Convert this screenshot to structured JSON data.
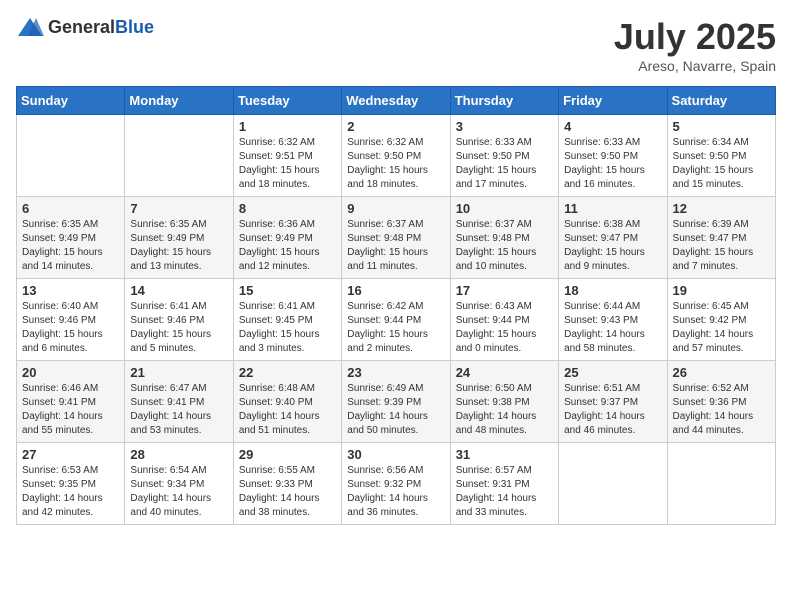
{
  "header": {
    "logo_general": "General",
    "logo_blue": "Blue",
    "month_year": "July 2025",
    "location": "Areso, Navarre, Spain"
  },
  "weekdays": [
    "Sunday",
    "Monday",
    "Tuesday",
    "Wednesday",
    "Thursday",
    "Friday",
    "Saturday"
  ],
  "weeks": [
    [
      {
        "day": "",
        "content": ""
      },
      {
        "day": "",
        "content": ""
      },
      {
        "day": "1",
        "content": "Sunrise: 6:32 AM\nSunset: 9:51 PM\nDaylight: 15 hours and 18 minutes."
      },
      {
        "day": "2",
        "content": "Sunrise: 6:32 AM\nSunset: 9:50 PM\nDaylight: 15 hours and 18 minutes."
      },
      {
        "day": "3",
        "content": "Sunrise: 6:33 AM\nSunset: 9:50 PM\nDaylight: 15 hours and 17 minutes."
      },
      {
        "day": "4",
        "content": "Sunrise: 6:33 AM\nSunset: 9:50 PM\nDaylight: 15 hours and 16 minutes."
      },
      {
        "day": "5",
        "content": "Sunrise: 6:34 AM\nSunset: 9:50 PM\nDaylight: 15 hours and 15 minutes."
      }
    ],
    [
      {
        "day": "6",
        "content": "Sunrise: 6:35 AM\nSunset: 9:49 PM\nDaylight: 15 hours and 14 minutes."
      },
      {
        "day": "7",
        "content": "Sunrise: 6:35 AM\nSunset: 9:49 PM\nDaylight: 15 hours and 13 minutes."
      },
      {
        "day": "8",
        "content": "Sunrise: 6:36 AM\nSunset: 9:49 PM\nDaylight: 15 hours and 12 minutes."
      },
      {
        "day": "9",
        "content": "Sunrise: 6:37 AM\nSunset: 9:48 PM\nDaylight: 15 hours and 11 minutes."
      },
      {
        "day": "10",
        "content": "Sunrise: 6:37 AM\nSunset: 9:48 PM\nDaylight: 15 hours and 10 minutes."
      },
      {
        "day": "11",
        "content": "Sunrise: 6:38 AM\nSunset: 9:47 PM\nDaylight: 15 hours and 9 minutes."
      },
      {
        "day": "12",
        "content": "Sunrise: 6:39 AM\nSunset: 9:47 PM\nDaylight: 15 hours and 7 minutes."
      }
    ],
    [
      {
        "day": "13",
        "content": "Sunrise: 6:40 AM\nSunset: 9:46 PM\nDaylight: 15 hours and 6 minutes."
      },
      {
        "day": "14",
        "content": "Sunrise: 6:41 AM\nSunset: 9:46 PM\nDaylight: 15 hours and 5 minutes."
      },
      {
        "day": "15",
        "content": "Sunrise: 6:41 AM\nSunset: 9:45 PM\nDaylight: 15 hours and 3 minutes."
      },
      {
        "day": "16",
        "content": "Sunrise: 6:42 AM\nSunset: 9:44 PM\nDaylight: 15 hours and 2 minutes."
      },
      {
        "day": "17",
        "content": "Sunrise: 6:43 AM\nSunset: 9:44 PM\nDaylight: 15 hours and 0 minutes."
      },
      {
        "day": "18",
        "content": "Sunrise: 6:44 AM\nSunset: 9:43 PM\nDaylight: 14 hours and 58 minutes."
      },
      {
        "day": "19",
        "content": "Sunrise: 6:45 AM\nSunset: 9:42 PM\nDaylight: 14 hours and 57 minutes."
      }
    ],
    [
      {
        "day": "20",
        "content": "Sunrise: 6:46 AM\nSunset: 9:41 PM\nDaylight: 14 hours and 55 minutes."
      },
      {
        "day": "21",
        "content": "Sunrise: 6:47 AM\nSunset: 9:41 PM\nDaylight: 14 hours and 53 minutes."
      },
      {
        "day": "22",
        "content": "Sunrise: 6:48 AM\nSunset: 9:40 PM\nDaylight: 14 hours and 51 minutes."
      },
      {
        "day": "23",
        "content": "Sunrise: 6:49 AM\nSunset: 9:39 PM\nDaylight: 14 hours and 50 minutes."
      },
      {
        "day": "24",
        "content": "Sunrise: 6:50 AM\nSunset: 9:38 PM\nDaylight: 14 hours and 48 minutes."
      },
      {
        "day": "25",
        "content": "Sunrise: 6:51 AM\nSunset: 9:37 PM\nDaylight: 14 hours and 46 minutes."
      },
      {
        "day": "26",
        "content": "Sunrise: 6:52 AM\nSunset: 9:36 PM\nDaylight: 14 hours and 44 minutes."
      }
    ],
    [
      {
        "day": "27",
        "content": "Sunrise: 6:53 AM\nSunset: 9:35 PM\nDaylight: 14 hours and 42 minutes."
      },
      {
        "day": "28",
        "content": "Sunrise: 6:54 AM\nSunset: 9:34 PM\nDaylight: 14 hours and 40 minutes."
      },
      {
        "day": "29",
        "content": "Sunrise: 6:55 AM\nSunset: 9:33 PM\nDaylight: 14 hours and 38 minutes."
      },
      {
        "day": "30",
        "content": "Sunrise: 6:56 AM\nSunset: 9:32 PM\nDaylight: 14 hours and 36 minutes."
      },
      {
        "day": "31",
        "content": "Sunrise: 6:57 AM\nSunset: 9:31 PM\nDaylight: 14 hours and 33 minutes."
      },
      {
        "day": "",
        "content": ""
      },
      {
        "day": "",
        "content": ""
      }
    ]
  ]
}
